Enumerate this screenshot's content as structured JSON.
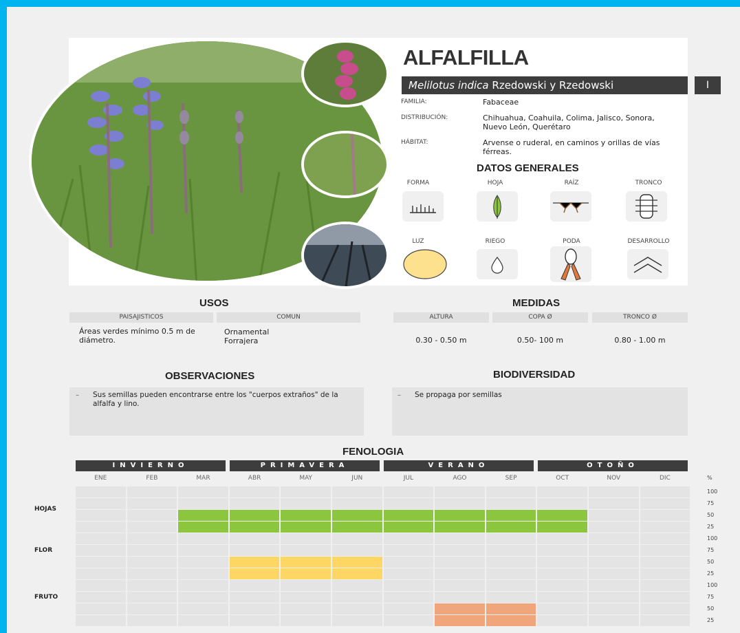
{
  "header": {
    "common_name": "ALFALFILLA",
    "scientific_name": "Melilotus indica",
    "authors": "Rzedowski y Rzedowski",
    "number": "I"
  },
  "info": {
    "familia_label": "FAMILIA:",
    "familia": "Fabaceae",
    "distribucion_label": "DISTRIBUCIÓN:",
    "distribucion": "Chihuahua, Coahuila, Colima, Jalisco, Sonora, Nuevo León, Querétaro",
    "habitat_label": "HÁBITAT:",
    "habitat": "Arvense o ruderal, en caminos y orillas de vías férreas."
  },
  "datos_generales": {
    "title": "DATOS GENERALES",
    "labels": [
      "FORMA",
      "HOJA",
      "RAÍZ",
      "TRONCO",
      "LUZ",
      "RIEGO",
      "PODA",
      "DESARROLLO"
    ],
    "icons": [
      "grass-form-icon",
      "leaf-icon",
      "root-icon",
      "trunk-icon",
      "sun-icon",
      "water-drop-icon",
      "pruning-shears-icon",
      "growth-chevron-icon"
    ]
  },
  "usos": {
    "title": "USOS",
    "headers": [
      "PAISAJISTICOS",
      "COMUN"
    ],
    "paisajisticos": "Áreas verdes mínimo 0.5 m de diámetro.",
    "comun": "Ornamental\nForrajera"
  },
  "medidas": {
    "title": "MEDIDAS",
    "headers": [
      "ALTURA",
      "COPA Ø",
      "TRONCO Ø"
    ],
    "values": [
      "0.30 - 0.50 m",
      "0.50- 100 m",
      "0.80 - 1.00 m"
    ]
  },
  "observaciones": {
    "title": "OBSERVACIONES",
    "text": "Sus semillas pueden encontrarse entre los \"cuerpos extraños\" de la alfalfa y lino."
  },
  "biodiversidad": {
    "title": "BIODIVERSIDAD",
    "text": "Se propaga por semillas"
  },
  "fenologia": {
    "title": "FENOLOGIA",
    "seasons": [
      "INVIERNO",
      "PRIMAVERA",
      "VERANO",
      "OTOÑO"
    ],
    "months": [
      "ENE",
      "FEB",
      "MAR",
      "ABR",
      "MAY",
      "JUN",
      "JUL",
      "AGO",
      "SEP",
      "OCT",
      "NOV",
      "DIC"
    ],
    "percent_label": "%",
    "percent_ticks": [
      "100",
      "75",
      "50",
      "25"
    ],
    "rows": [
      {
        "label": "HOJAS",
        "color": "#8cc63f",
        "level": 50,
        "months": [
          "MAR",
          "ABR",
          "MAY",
          "JUN",
          "JUL",
          "AGO",
          "SEP",
          "OCT"
        ]
      },
      {
        "label": "FLOR",
        "color": "#fdd663",
        "level": 50,
        "months": [
          "ABR",
          "MAY",
          "JUN"
        ]
      },
      {
        "label": "FRUTO",
        "color": "#f0a57a",
        "level": 50,
        "months": [
          "AGO",
          "SEP"
        ]
      }
    ]
  }
}
